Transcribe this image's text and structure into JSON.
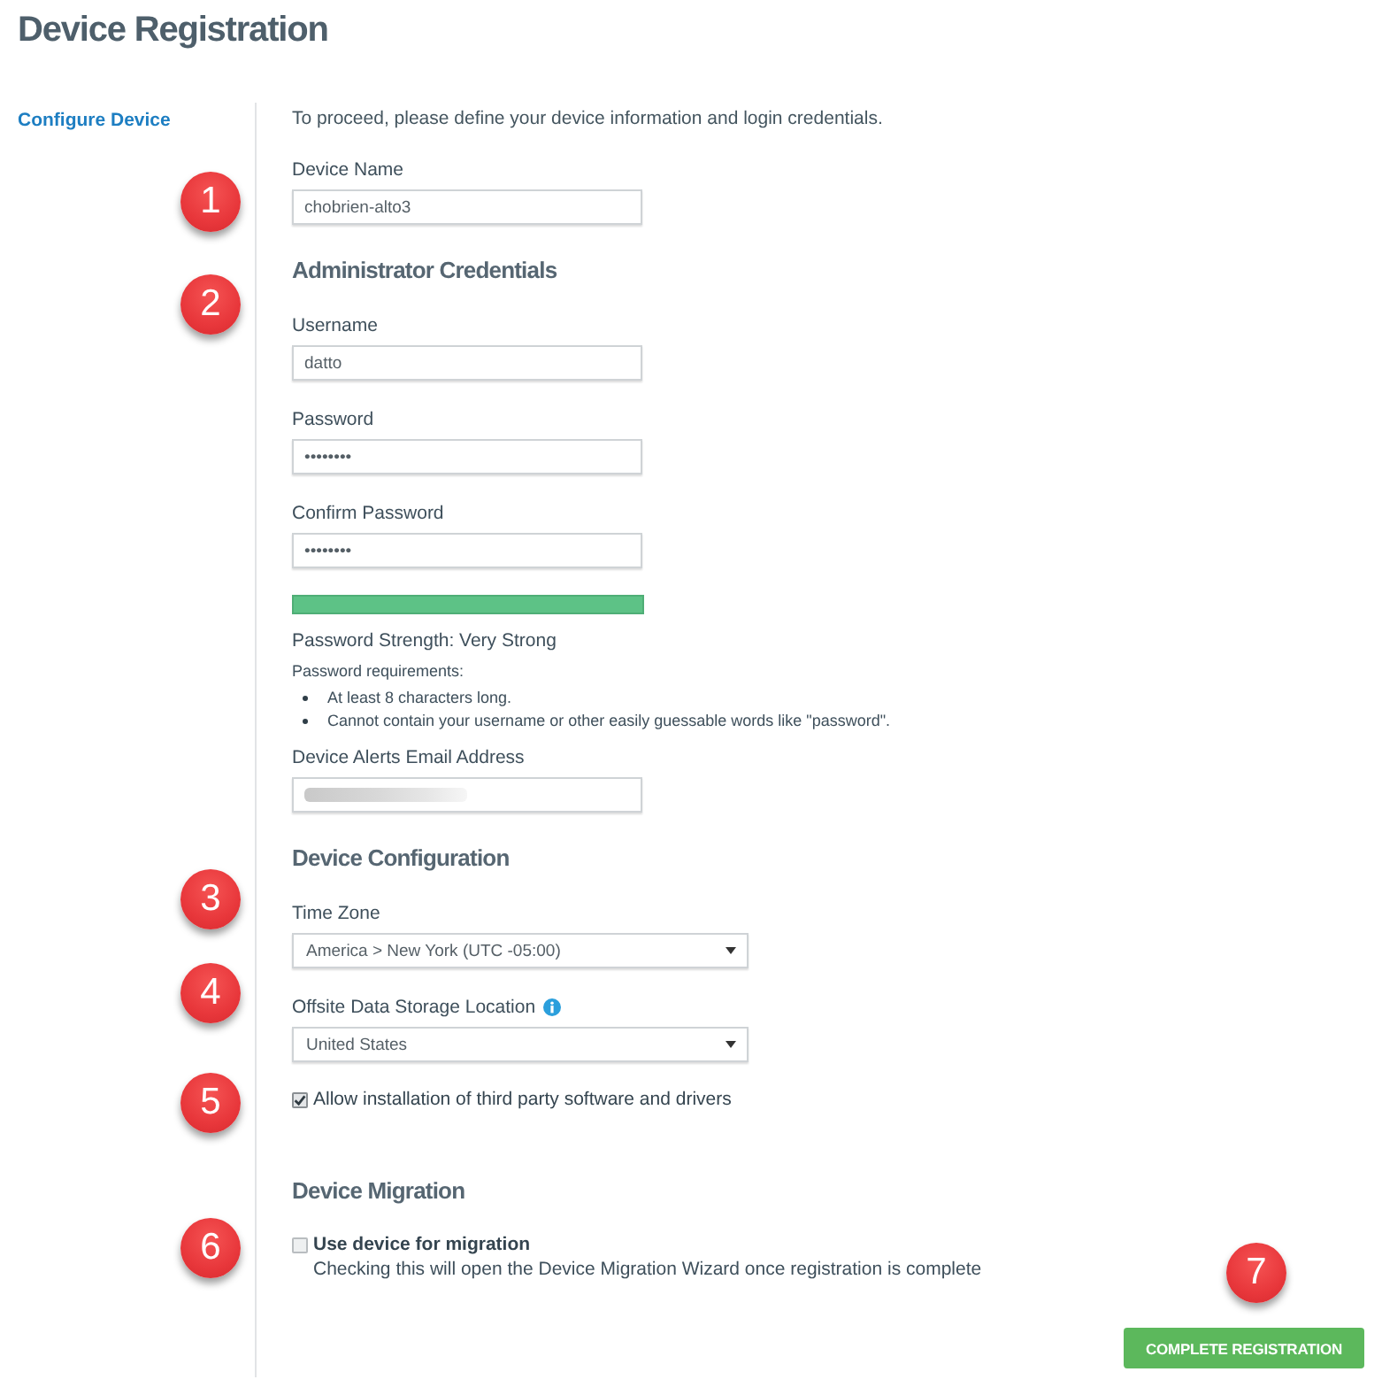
{
  "page": {
    "title": "Device Registration"
  },
  "sidebar": {
    "items": [
      {
        "label": "Configure Device",
        "selected": true
      }
    ]
  },
  "intro": "To proceed, please define your device information and login credentials.",
  "sections": [
    {
      "items": [
        {
          "kind": "text",
          "label": "Device Name",
          "value": "chobrien-alto3",
          "callout": "1"
        }
      ]
    },
    {
      "heading": "Administrator Credentials",
      "callout": "2",
      "items": [
        {
          "kind": "text",
          "label": "Username",
          "value": "datto"
        },
        {
          "kind": "password",
          "label": "Password",
          "value": "••••••••"
        },
        {
          "kind": "password",
          "label": "Confirm Password",
          "value": "••••••••"
        },
        {
          "kind": "meter",
          "level": 1,
          "reading": "Password Strength: Very Strong"
        },
        {
          "kind": "requirements",
          "title": "Password requirements:",
          "items": [
            "At least 8 characters long.",
            "Cannot contain your username or other easily guessable words like \"password\"."
          ]
        },
        {
          "kind": "text",
          "label": "Device Alerts Email Address",
          "redacted": true
        }
      ]
    },
    {
      "heading": "Device Configuration",
      "items": [
        {
          "kind": "select",
          "label": "Time Zone",
          "value": "America > New York (UTC -05:00)",
          "callout": "3"
        },
        {
          "kind": "select",
          "label": "Offsite Data Storage Location",
          "info": true,
          "value": "United States",
          "callout": "4"
        },
        {
          "kind": "checkbox",
          "label": "Allow installation of third party software and drivers",
          "checked": true,
          "callout": "5"
        }
      ]
    },
    {
      "heading": "Device Migration",
      "items": [
        {
          "kind": "checkbox",
          "label": "Use device for migration",
          "description": "Checking this will open the Device Migration Wizard once registration is complete",
          "checked": false,
          "callout": "6"
        }
      ]
    }
  ],
  "submit": {
    "label": "COMPLETE REGISTRATION",
    "callout": "7"
  }
}
